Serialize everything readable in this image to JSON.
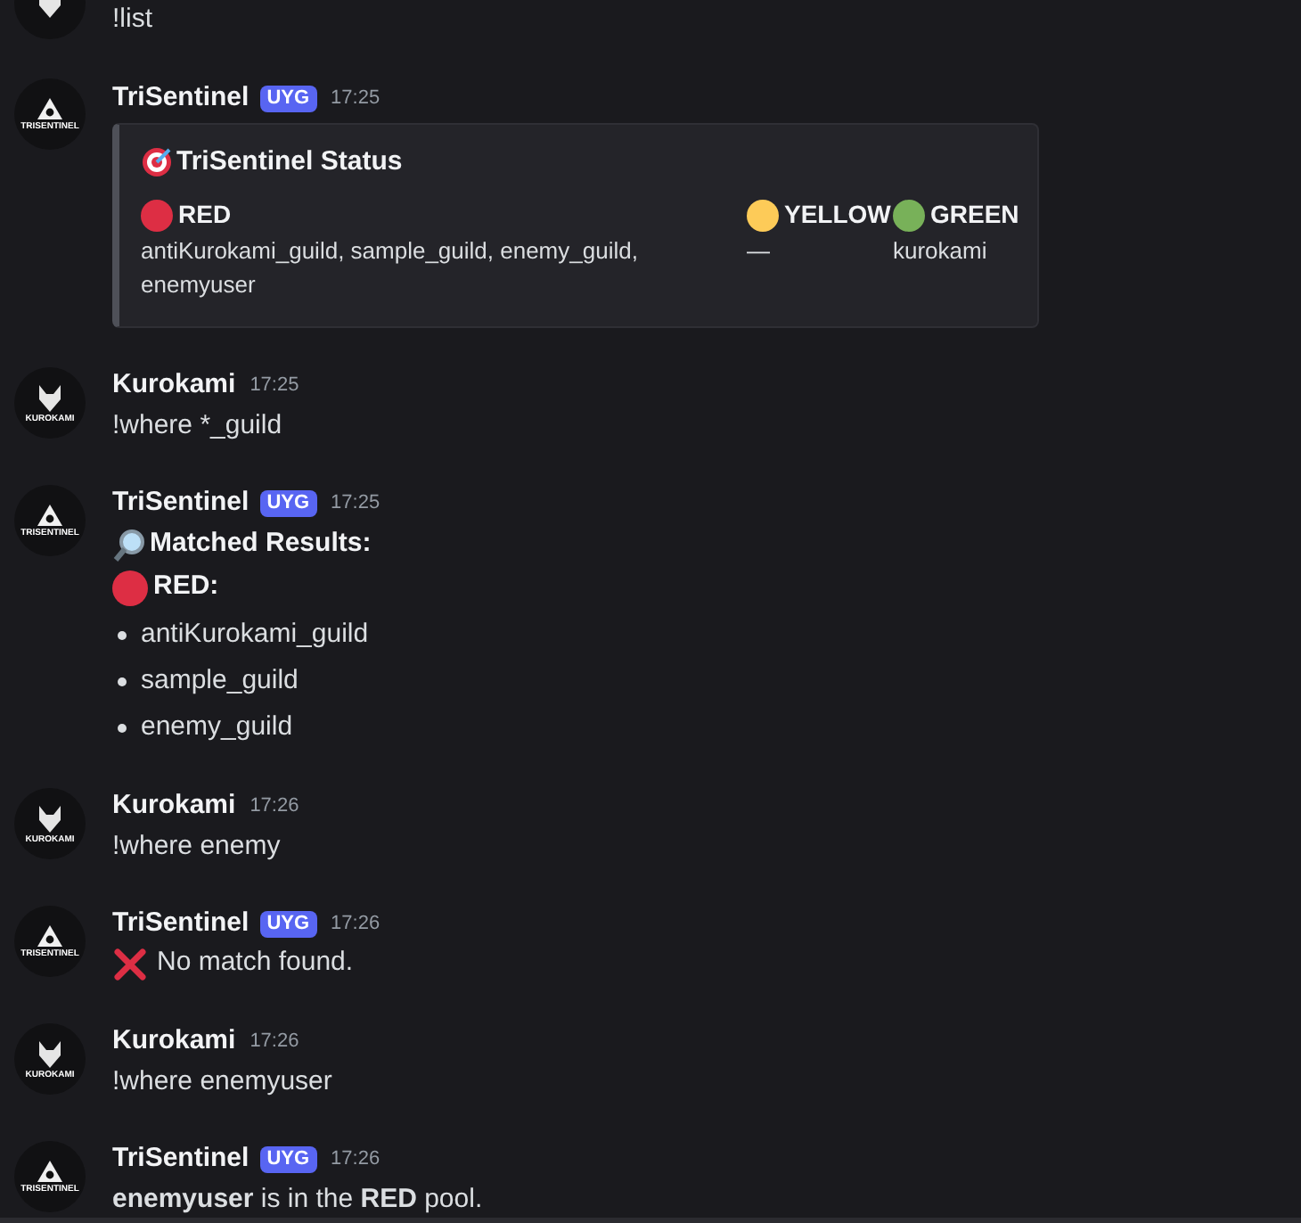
{
  "messages": [
    {
      "kind": "text",
      "avatar": {
        "kind": "wolf"
      },
      "text": "!list"
    },
    {
      "kind": "embed",
      "avatar": {
        "kind": "eye",
        "label": "TRISENTINEL"
      },
      "author": "TriSentinel",
      "tag": "UYG",
      "time": "17:25",
      "embed": {
        "title": "TriSentinel Status",
        "fields": [
          {
            "name": "RED",
            "color": "#dd2e44",
            "value": "antiKurokami_guild, sample_guild, enemy_guild, enemyuser"
          },
          {
            "name": "YELLOW",
            "color": "#fdcb58",
            "value": "—"
          },
          {
            "name": "GREEN",
            "color": "#78b159",
            "value": "kurokami"
          }
        ]
      }
    },
    {
      "kind": "text",
      "avatar": {
        "kind": "wolf",
        "label": "KUROKAMI"
      },
      "author": "Kurokami",
      "time": "17:25",
      "text": "!where *_guild"
    },
    {
      "kind": "results",
      "avatar": {
        "kind": "eye",
        "label": "TRISENTINEL"
      },
      "author": "TriSentinel",
      "tag": "UYG",
      "time": "17:25",
      "heading": "Matched Results:",
      "group": {
        "name": "RED:",
        "color": "#dd2e44"
      },
      "items": [
        "antiKurokami_guild",
        "sample_guild",
        "enemy_guild"
      ]
    },
    {
      "kind": "text",
      "avatar": {
        "kind": "wolf",
        "label": "KUROKAMI"
      },
      "author": "Kurokami",
      "time": "17:26",
      "text": "!where enemy"
    },
    {
      "kind": "error",
      "avatar": {
        "kind": "eye",
        "label": "TRISENTINEL"
      },
      "author": "TriSentinel",
      "tag": "UYG",
      "time": "17:26",
      "text": "No match found."
    },
    {
      "kind": "text",
      "avatar": {
        "kind": "wolf",
        "label": "KUROKAMI"
      },
      "author": "Kurokami",
      "time": "17:26",
      "text": "!where enemyuser"
    },
    {
      "kind": "text",
      "avatar": {
        "kind": "eye",
        "label": "TRISENTINEL"
      },
      "author": "TriSentinel",
      "tag": "UYG",
      "time": "17:26",
      "text": "**enemyuser** is in the **RED** pool."
    }
  ]
}
